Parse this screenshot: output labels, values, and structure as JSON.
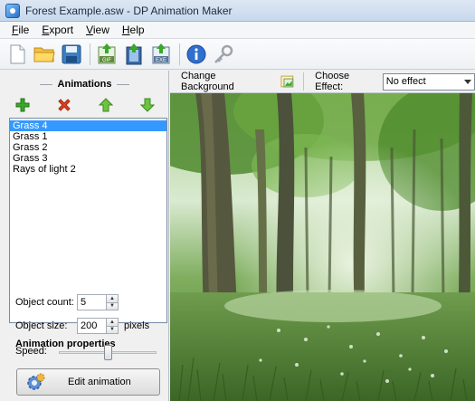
{
  "window": {
    "title": "Forest Example.asw - DP Animation Maker"
  },
  "menu": [
    {
      "underline": "F",
      "rest": "ile"
    },
    {
      "underline": "E",
      "rest": "xport"
    },
    {
      "underline": "V",
      "rest": "iew"
    },
    {
      "underline": "H",
      "rest": "elp"
    }
  ],
  "toolbar": {
    "buttons": [
      "new-file-icon",
      "open-folder-icon",
      "save-disk-icon",
      "export-gif-icon",
      "export-video-icon",
      "export-exe-icon",
      "info-icon",
      "register-key-icon"
    ],
    "gif_badge": "GIF",
    "exe_badge": "EXE"
  },
  "animations_panel": {
    "heading": "Animations",
    "tools": [
      "add-icon",
      "delete-icon",
      "move-up-icon",
      "move-down-icon"
    ],
    "items": [
      "Grass 4",
      "Grass 1",
      "Grass 2",
      "Grass 3",
      "Rays of light 2"
    ],
    "selected_index": 0
  },
  "properties": {
    "title": "Animation properties",
    "object_count_label": "Object count:",
    "object_count_value": "5",
    "object_size_label": "Object size:",
    "object_size_value": "200",
    "object_size_unit": "pixels",
    "speed_label": "Speed:",
    "speed_level": 0.5
  },
  "edit_button": {
    "label": "Edit animation"
  },
  "right_toolbar": {
    "change_background_label": "Change Background",
    "choose_effect_label": "Choose Effect:",
    "effect_value": "No effect"
  },
  "colors": {
    "selection": "#3399ff",
    "add_green": "#3aa82a",
    "delete_red": "#e0411e"
  }
}
